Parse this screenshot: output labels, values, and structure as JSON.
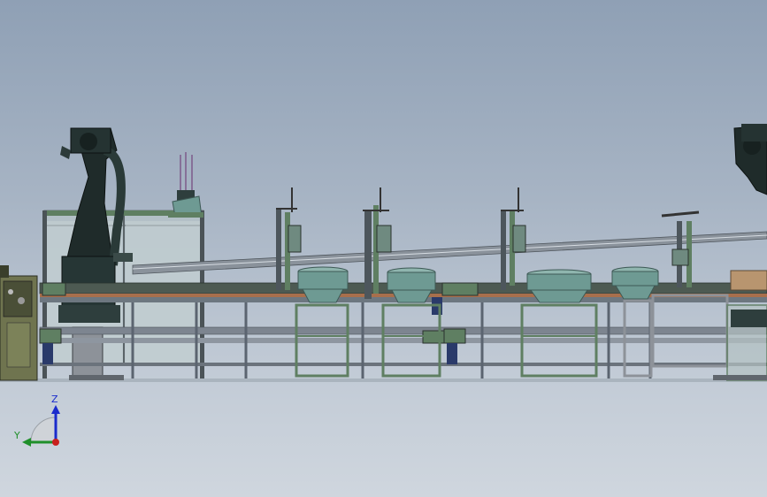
{
  "viewport": {
    "background_top": "#8fa0b5",
    "background_bottom": "#cfd6de"
  },
  "model": {
    "description_visible": false,
    "colors": {
      "frame_green": "#5f7f62",
      "frame_gray": "#8d9299",
      "bowl_teal": "#6e9a93",
      "robot_dark": "#1f2b2a",
      "cabinet_olive": "#6f744f",
      "glass_panel": "#b9c6c9",
      "rail_metal": "#7d8590"
    }
  },
  "triad": {
    "z_label": "Z",
    "y_label": "Y",
    "z_color": "#1a2bcc",
    "y_color": "#1f8f2a",
    "x_color": "#c8201e"
  }
}
